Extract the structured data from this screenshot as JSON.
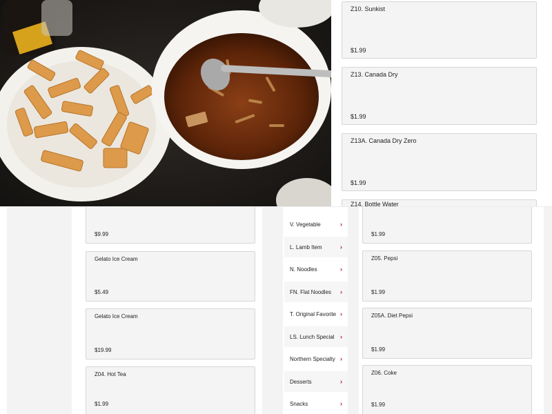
{
  "photo": {
    "alt_icon": "food-photo"
  },
  "top_right": {
    "cards": [
      {
        "name": "Z10. Sunkist",
        "price": "$1.99"
      },
      {
        "name": "Z13. Canada Dry",
        "price": "$1.99"
      },
      {
        "name": "Z13A. Canada Dry Zero",
        "price": "$1.99"
      },
      {
        "name": "Z14. Bottle Water",
        "price": ""
      }
    ]
  },
  "bottom_left": {
    "cards": [
      {
        "name": "",
        "price": "$9.99"
      },
      {
        "name": "Gelato Ice Cream",
        "price": "$5.49"
      },
      {
        "name": "Gelato Ice Cream",
        "price": "$19.99"
      },
      {
        "name": "Z04. Hot Tea",
        "price": "$1.99"
      }
    ]
  },
  "bottom_right": {
    "categories": [
      {
        "label": "V. Vegetable"
      },
      {
        "label": "L. Lamb Item"
      },
      {
        "label": "N. Noodles"
      },
      {
        "label": "FN. Flat Noodles"
      },
      {
        "label": "T. Original Favorite"
      },
      {
        "label": "LS. Lunch Special"
      },
      {
        "label": "Northern Specialty"
      },
      {
        "label": "Desserts"
      },
      {
        "label": "Snacks"
      }
    ],
    "chevron": "›",
    "cards": [
      {
        "name": "",
        "price": "$1.99"
      },
      {
        "name": "Z05. Pepsi",
        "price": "$1.99"
      },
      {
        "name": "Z05A. Diet Pepsi",
        "price": "$1.99"
      },
      {
        "name": "Z06. Coke",
        "price": "$1.99"
      }
    ]
  },
  "colors": {
    "accent": "#b1152a",
    "card_bg": "#f4f4f4",
    "card_border": "#d6d6d6"
  }
}
